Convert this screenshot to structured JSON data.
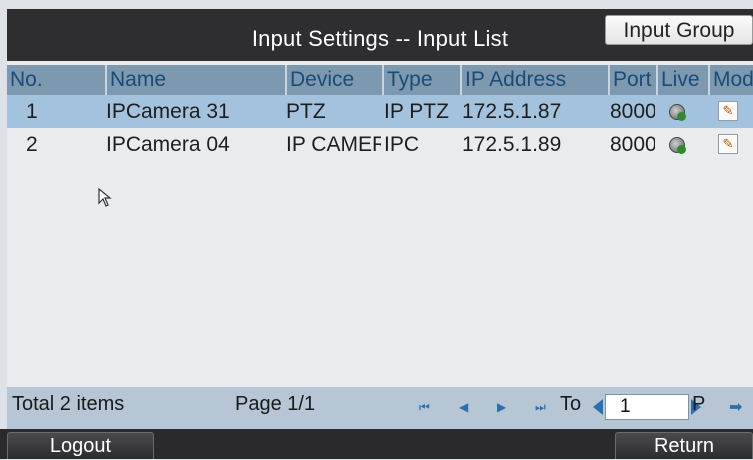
{
  "window": {
    "title": "Input Settings -- Input List",
    "input_group_label": "Input Group"
  },
  "table": {
    "columns": [
      "No.",
      "Name",
      "Device",
      "Type",
      "IP Address",
      "Port",
      "Live",
      "Mod"
    ],
    "rows": [
      {
        "no": "1",
        "name": "IPCamera 31",
        "device": "PTZ",
        "type": "IP PTZ",
        "ip": "172.5.1.87",
        "port": "8000",
        "live_icon": "camera-live-icon",
        "mod_icon": "edit-icon",
        "selected": true
      },
      {
        "no": "2",
        "name": "IPCamera 04",
        "device": "IP CAMERA",
        "type": "IPC",
        "ip": "172.5.1.89",
        "port": "8000",
        "live_icon": "camera-live-icon",
        "mod_icon": "edit-icon",
        "selected": false
      }
    ]
  },
  "footer": {
    "total": "Total 2 items",
    "page": "Page 1/1",
    "to_label": "To",
    "page_value": "1",
    "page_suffix": "P"
  },
  "bottom": {
    "logout": "Logout",
    "return": "Return"
  },
  "colors": {
    "titlebar": "#2e2e30",
    "header": "#7c99b0",
    "header_text": "#1b4b78",
    "selected_row": "#a3c2dd",
    "footer": "#b6c6d4"
  }
}
